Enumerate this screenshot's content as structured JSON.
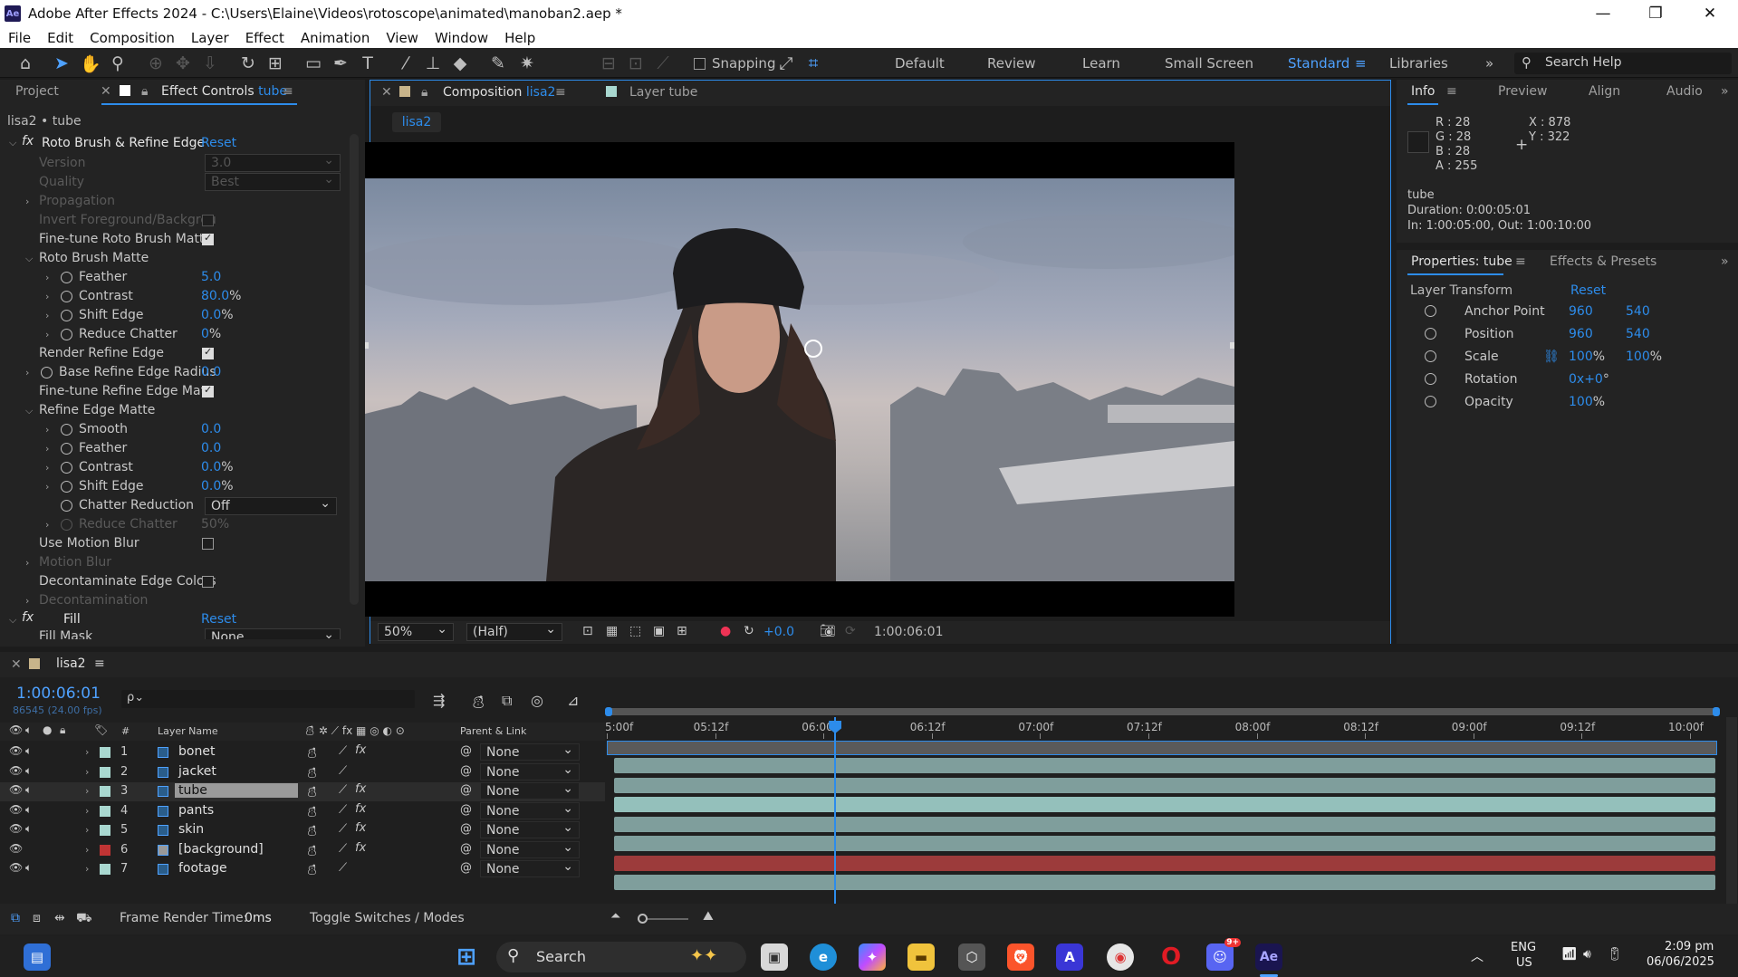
{
  "titlebar": {
    "title": "Adobe After Effects 2024 - C:\\Users\\Elaine\\Videos\\rotoscope\\animated\\manoban2.aep *",
    "logo": "Ae"
  },
  "menu": [
    "File",
    "Edit",
    "Composition",
    "Layer",
    "Effect",
    "Animation",
    "View",
    "Window",
    "Help"
  ],
  "toolbar": {
    "snapping": "Snapping",
    "workspaces": [
      "Default",
      "Review",
      "Learn",
      "Small Screen",
      "Standard",
      "Libraries"
    ],
    "search_placeholder": "Search Help"
  },
  "left_panel": {
    "tab_project": "Project",
    "tab_effect_controls": "Effect Controls",
    "tab_effect_layer": "tube",
    "breadcrumb": "lisa2 • tube",
    "roto": {
      "name": "Roto Brush & Refine Edge",
      "reset": "Reset",
      "version_label": "Version",
      "version_value": "3.0",
      "quality_label": "Quality",
      "quality_value": "Best",
      "propagation": "Propagation",
      "invert": "Invert Foreground/Backgrou",
      "finetune_roto": "Fine-tune Roto Brush Matte",
      "roto_matte": "Roto Brush Matte",
      "feather_label": "Feather",
      "feather_value": "5.0",
      "contrast_label": "Contrast",
      "contrast_value": "80.0",
      "shift_label": "Shift Edge",
      "shift_value": "0.0",
      "reduce_label": "Reduce Chatter",
      "reduce_value": "0",
      "render_refine": "Render Refine Edge",
      "base_radius_label": "Base Refine Edge Radius",
      "base_radius_value": "0.0",
      "finetune_refine": "Fine-tune Refine Edge Matt",
      "refine_matte": "Refine Edge Matte",
      "smooth_label": "Smooth",
      "smooth_value": "0.0",
      "feather2_label": "Feather",
      "feather2_value": "0.0",
      "contrast2_label": "Contrast",
      "contrast2_value": "0.0",
      "shift2_label": "Shift Edge",
      "shift2_value": "0.0",
      "chatter_label": "Chatter Reduction",
      "chatter_value": "Off",
      "reduce2_label": "Reduce Chatter",
      "reduce2_value": "50",
      "motion_blur_use": "Use Motion Blur",
      "motion_blur": "Motion Blur",
      "decontaminate": "Decontaminate Edge Colors",
      "decontamination": "Decontamination",
      "pct": "%"
    },
    "fill": {
      "name": "Fill",
      "reset": "Reset",
      "mask_label": "Fill Mask",
      "mask_value": "None"
    }
  },
  "comp_panel": {
    "tab_comp": "Composition",
    "comp_name": "lisa2",
    "tab_layer": "Layer",
    "layer_name": "tube",
    "sub_tab": "lisa2",
    "zoom": "50%",
    "resolution": "(Half)",
    "exposure": "+0.0",
    "timecode": "1:00:06:01"
  },
  "info_panel": {
    "tabs": [
      "Info",
      "Preview",
      "Align",
      "Audio"
    ],
    "r": "R : 28",
    "g": "G : 28",
    "b": "B : 28",
    "a": "A : 255",
    "x": "X : 878",
    "y": "Y : 322",
    "layer": "tube",
    "duration": "Duration: 0:00:05:01",
    "inout": "In: 1:00:05:00, Out: 1:00:10:00"
  },
  "properties_panel": {
    "tab": "Properties: tube",
    "tab2": "Effects & Presets",
    "section": "Layer Transform",
    "reset": "Reset",
    "anchor_label": "Anchor Point",
    "anchor_x": "960",
    "anchor_y": "540",
    "position_label": "Position",
    "position_x": "960",
    "position_y": "540",
    "scale_label": "Scale",
    "scale_x": "100",
    "scale_y": "100",
    "pct": "%",
    "rotation_label": "Rotation",
    "rotation_value": "0x+0",
    "deg": "°",
    "opacity_label": "Opacity",
    "opacity_value": "100"
  },
  "timeline": {
    "comp": "lisa2",
    "timecode": "1:00:06:01",
    "frames": "86545 (24.00 fps)",
    "search_placeholder": "ρ⌄",
    "col_hash": "#",
    "col_layer": "Layer Name",
    "col_parent": "Parent & Link",
    "ruler": [
      "5:00f",
      "05:12f",
      "06:00f",
      "06:12f",
      "07:00f",
      "07:12f",
      "08:00f",
      "08:12f",
      "09:00f",
      "09:12f",
      "10:00f"
    ],
    "playhead_fraction": 0.21,
    "layers": [
      {
        "num": "1",
        "name": "bonet",
        "parent": "None",
        "fx": true,
        "color": "#a9d8d0",
        "bar": "#7f9e9c"
      },
      {
        "num": "2",
        "name": "jacket",
        "parent": "None",
        "fx": false,
        "color": "#a9d8d0",
        "bar": "#7f9e9c"
      },
      {
        "num": "3",
        "name": "tube",
        "parent": "None",
        "fx": true,
        "color": "#a9d8d0",
        "bar": "#94c0bb"
      },
      {
        "num": "4",
        "name": "pants",
        "parent": "None",
        "fx": true,
        "color": "#a9d8d0",
        "bar": "#7f9e9c"
      },
      {
        "num": "5",
        "name": "skin",
        "parent": "None",
        "fx": true,
        "color": "#a9d8d0",
        "bar": "#7f9e9c"
      },
      {
        "num": "6",
        "name": "[background]",
        "parent": "None",
        "fx": true,
        "color": "#c03434",
        "bar": "#9c3b3b"
      },
      {
        "num": "7",
        "name": "footage",
        "parent": "None",
        "fx": false,
        "color": "#a9d8d0",
        "bar": "#7f9e9c"
      }
    ],
    "footer_render": "Frame Render Time:",
    "footer_render_value": "0ms",
    "footer_toggle": "Toggle Switches / Modes"
  },
  "taskbar": {
    "search": "Search",
    "lang1": "ENG",
    "lang2": "US",
    "time": "2:09 pm",
    "date": "06/06/2025",
    "discord_badge": "9+"
  }
}
